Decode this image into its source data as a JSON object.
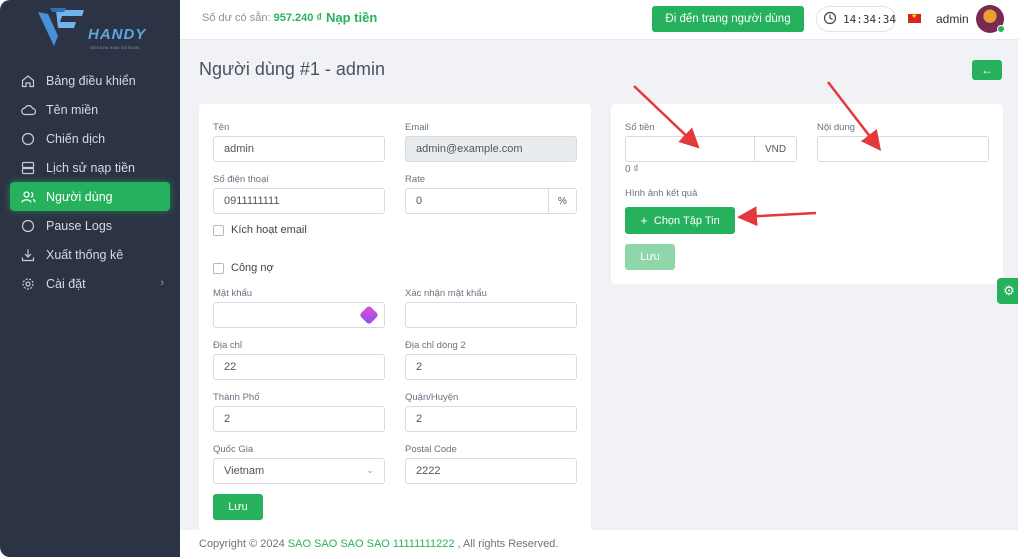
{
  "logo": {
    "text": "HANDY",
    "sub": "DESIGN AND DESIGN"
  },
  "sidebar": {
    "items": [
      {
        "label": "Bảng điều khiển",
        "icon": "home-icon"
      },
      {
        "label": "Tên miền",
        "icon": "cloud-icon"
      },
      {
        "label": "Chiến dịch",
        "icon": "circle-icon"
      },
      {
        "label": "Lịch sử nạp tiền",
        "icon": "server-icon"
      },
      {
        "label": "Người dùng",
        "icon": "users-icon"
      },
      {
        "label": "Pause Logs",
        "icon": "circle-icon"
      },
      {
        "label": "Xuất thống kê",
        "icon": "download-icon"
      },
      {
        "label": "Cài đặt",
        "icon": "gear-icon"
      }
    ],
    "active_index": 4
  },
  "topbar": {
    "balance_label": "Số dư có sẵn:",
    "balance_value": "957.240 ₫",
    "topup": "Nạp tiền",
    "goto_user": "Đi đến trang người dùng",
    "clock": "14:34:34",
    "username": "admin"
  },
  "page": {
    "title": "Người dùng #1 - admin"
  },
  "form": {
    "name_label": "Tên",
    "name_value": "admin",
    "email_label": "Email",
    "email_value": "admin@example.com",
    "phone_label": "Số điện thoại",
    "phone_value": "0911111111",
    "rate_label": "Rate",
    "rate_value": "0",
    "rate_suffix": "%",
    "activate_email": "Kích hoạt email",
    "debt": "Công nợ",
    "password_label": "Mật khẩu",
    "confirm_label": "Xác nhận mật khẩu",
    "address_label": "Địa chỉ",
    "address_value": "22",
    "address2_label": "Địa chỉ dòng 2",
    "address2_value": "2",
    "city_label": "Thành Phố",
    "city_value": "2",
    "district_label": "Quận/Huyện",
    "district_value": "2",
    "country_label": "Quốc Gia",
    "country_value": "Vietnam",
    "postal_label": "Postal Code",
    "postal_value": "2222",
    "save": "Lưu"
  },
  "topup_form": {
    "amount_label": "Số tiền",
    "amount_suffix": "VND",
    "amount_hint": "0 ₫",
    "content_label": "Nội dung",
    "result_image_label": "Hình ảnh kết quả",
    "choose_file": "Chọn Tập Tin",
    "save": "Lưu"
  },
  "footer": {
    "prefix": "Copyright © 2024",
    "brand": "SAO SAO SAO SAO 11111111222",
    "suffix": ", All rights Reserved."
  },
  "colors": {
    "accent": "#26b15d",
    "sidebar_bg": "#2c3344",
    "arrow": "#e5383b"
  }
}
